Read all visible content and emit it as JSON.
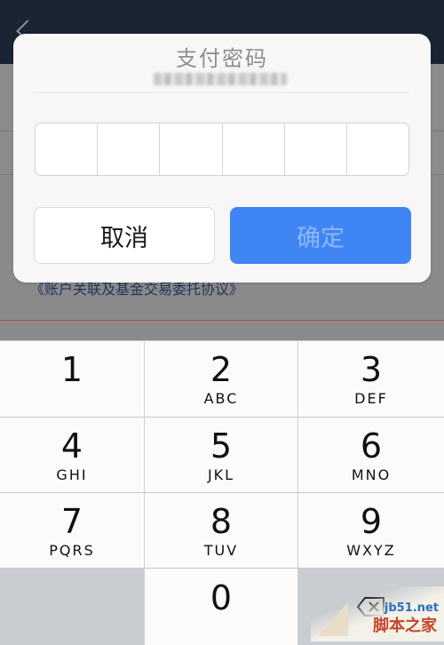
{
  "background": {
    "agreement_link": "《账户关联及基金交易委托协议》"
  },
  "dialog": {
    "title": "支付密码",
    "account_masked": "",
    "pin_length": 6,
    "cancel_label": "取消",
    "confirm_label": "确定",
    "colors": {
      "confirm_bg": "#3f86f4",
      "confirm_text_disabled": "#8fb8f6"
    }
  },
  "keypad": {
    "keys": [
      {
        "digit": "1",
        "letters": ""
      },
      {
        "digit": "2",
        "letters": "ABC"
      },
      {
        "digit": "3",
        "letters": "DEF"
      },
      {
        "digit": "4",
        "letters": "GHI"
      },
      {
        "digit": "5",
        "letters": "JKL"
      },
      {
        "digit": "6",
        "letters": "MNO"
      },
      {
        "digit": "7",
        "letters": "PQRS"
      },
      {
        "digit": "8",
        "letters": "TUV"
      },
      {
        "digit": "9",
        "letters": "WXYZ"
      },
      {
        "digit": "0",
        "letters": ""
      }
    ],
    "delete_icon": "backspace-icon"
  },
  "watermark": {
    "url": "jb51.net",
    "name": "脚本之家"
  }
}
